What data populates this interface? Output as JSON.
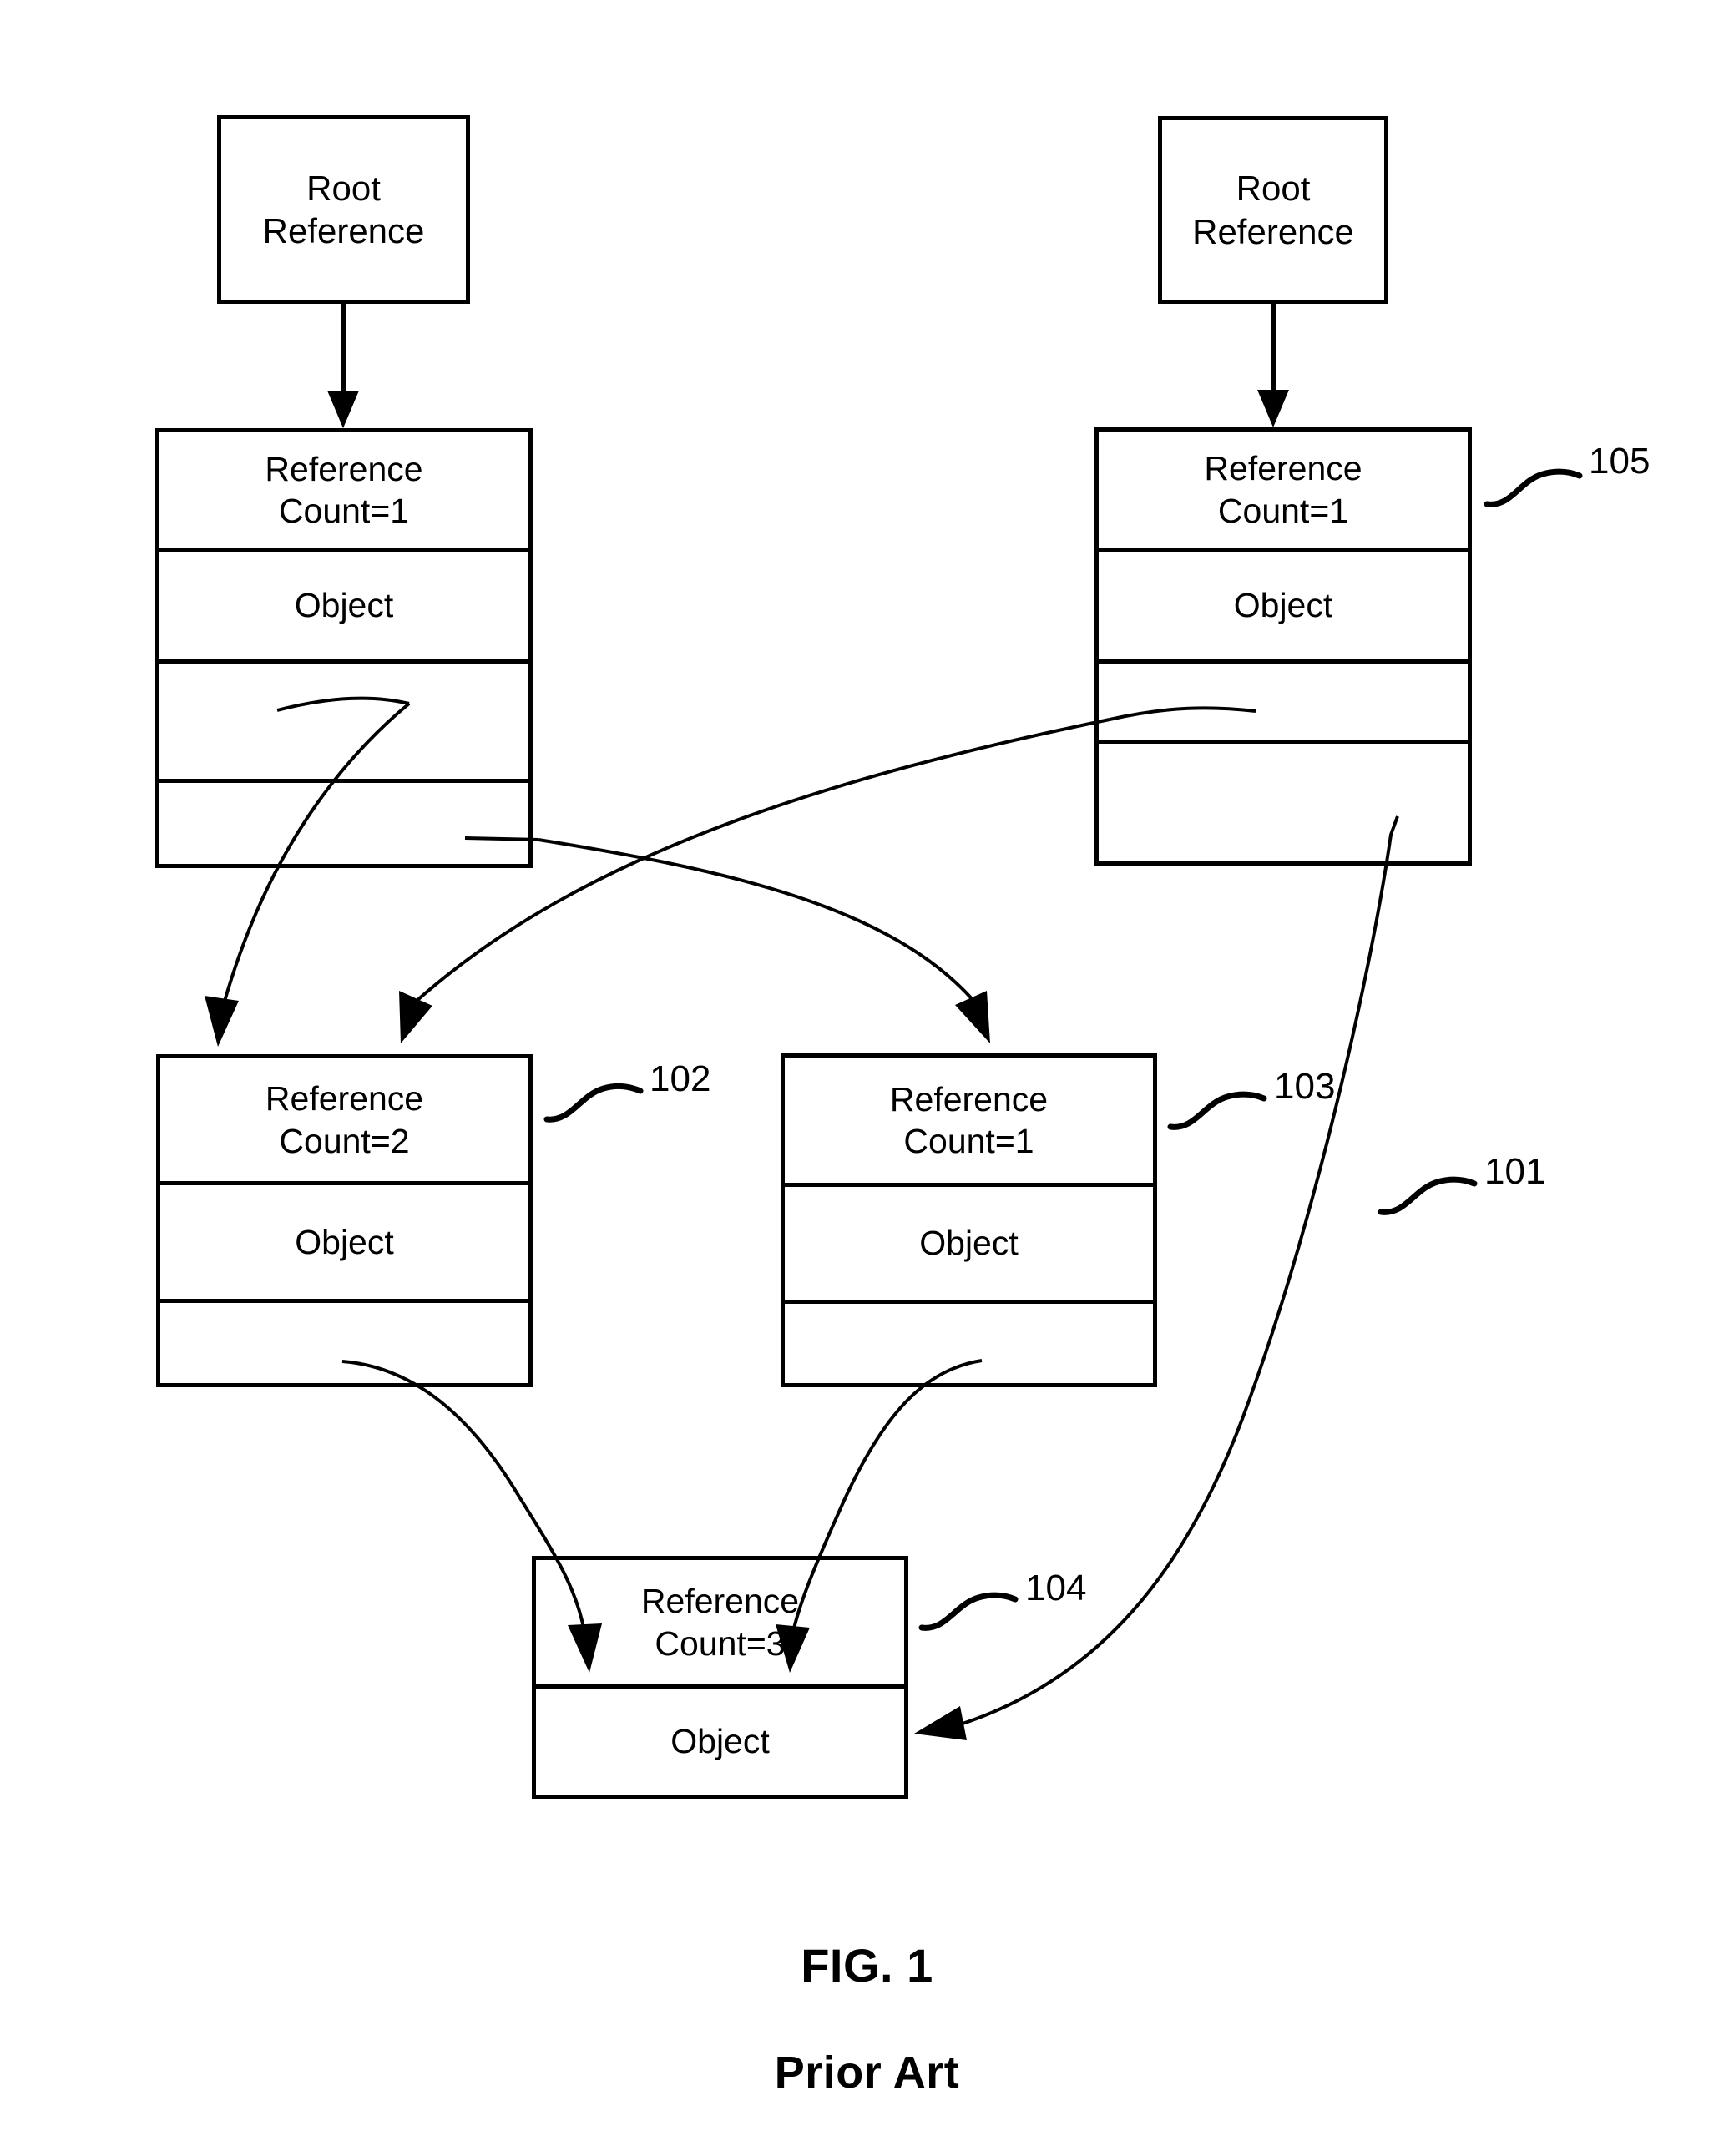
{
  "figure": {
    "label": "FIG. 1",
    "subtitle": "Prior Art"
  },
  "nodes": {
    "root_left": {
      "name": "root-reference-left",
      "line1": "Root",
      "line2": "Reference"
    },
    "root_right": {
      "name": "root-reference-right",
      "line1": "Root",
      "line2": "Reference"
    },
    "object_left_top": {
      "ref_line1": "Reference",
      "ref_line2": "Count=1",
      "object_label": "Object",
      "slot3": "",
      "slot4": ""
    },
    "object_105": {
      "numeral": "105",
      "ref_line1": "Reference",
      "ref_line2": "Count=1",
      "object_label": "Object",
      "slot3": "",
      "slot4": ""
    },
    "object_102": {
      "numeral": "102",
      "ref_line1": "Reference",
      "ref_line2": "Count=2",
      "object_label": "Object",
      "slot3": ""
    },
    "object_103": {
      "numeral": "103",
      "ref_line1": "Reference",
      "ref_line2": "Count=1",
      "object_label": "Object",
      "slot3": ""
    },
    "object_104": {
      "numeral": "104",
      "ref_line1": "Reference",
      "ref_line2": "Count=3",
      "object_label": "Object"
    }
  },
  "numerals": {
    "n101": "101",
    "n102": "102",
    "n103": "103",
    "n104": "104",
    "n105": "105"
  },
  "colors": {
    "ink": "#000000",
    "paper": "#ffffff"
  }
}
